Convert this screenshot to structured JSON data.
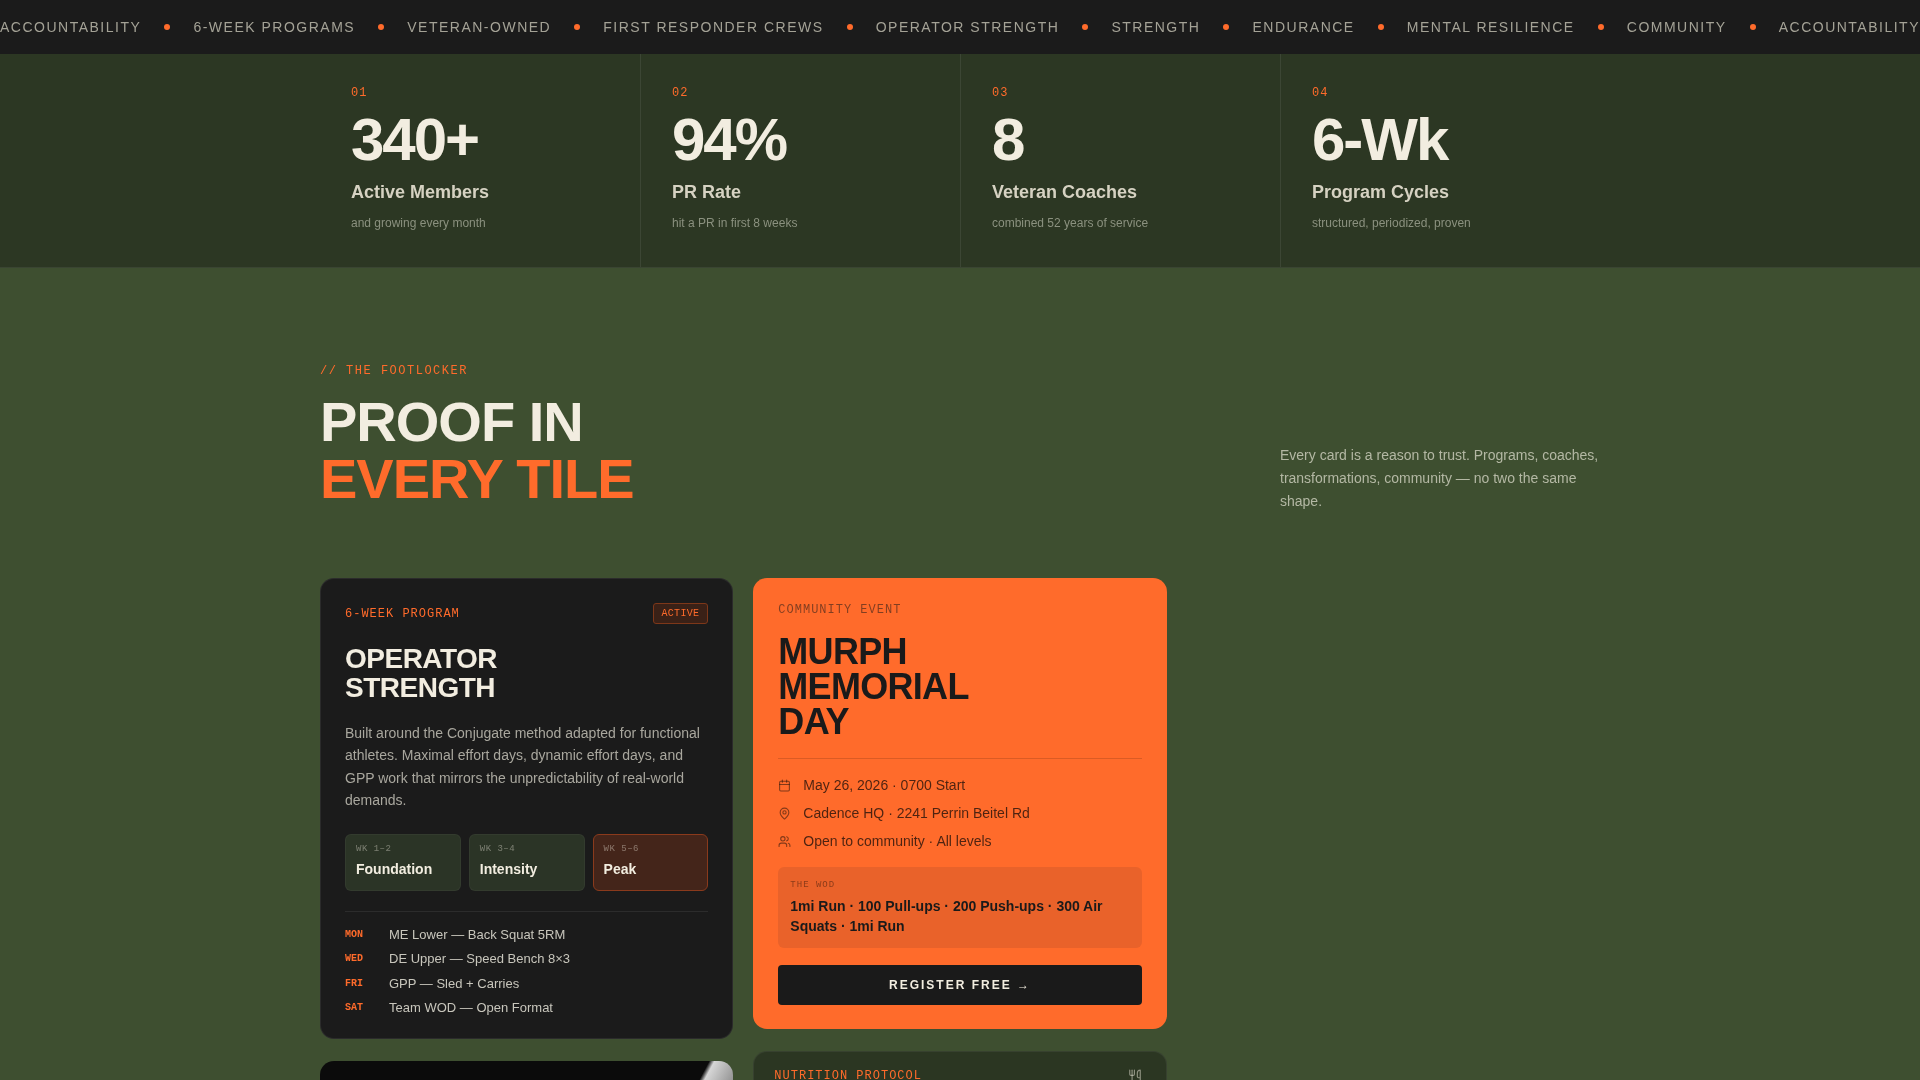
{
  "ticker": {
    "items": [
      "ACCOUNTABILITY",
      "6-WEEK PROGRAMS",
      "VETERAN-OWNED",
      "FIRST RESPONDER CREWS",
      "OPERATOR STRENGTH",
      "STRENGTH",
      "ENDURANCE",
      "MENTAL RESILIENCE",
      "COMMUNITY",
      "ACCOUNTABILITY"
    ]
  },
  "stats": [
    {
      "index": "01",
      "value": "340+",
      "label": "Active Members",
      "note": "and growing every month"
    },
    {
      "index": "02",
      "value": "94%",
      "label": "PR Rate",
      "note": "hit a PR in first 8 weeks"
    },
    {
      "index": "03",
      "value": "8",
      "label": "Veteran Coaches",
      "note": "combined 52 years of service"
    },
    {
      "index": "04",
      "value": "6-Wk",
      "label": "Program Cycles",
      "note": "structured, periodized, proven"
    }
  ],
  "section": {
    "eyebrow": "// THE FOOTLOCKER",
    "title": "PROOF IN",
    "title_accent": "EVERY TILE",
    "intro": "Every card is a reason to trust. Programs, coaches, transformations, community — no two the same shape."
  },
  "tile_columns": [
    [
      {
        "kind": "program",
        "eyebrow": "6-WEEK PROGRAM",
        "badge": "ACTIVE",
        "title": "OPERATOR STRENGTH",
        "description": "Built around the Conjugate method adapted for functional athletes. Maximal effort days, dynamic effort days, and GPP work that mirrors the unpredictability of real-world demands.",
        "phases": [
          {
            "weeks": "WK 1–2",
            "name": "Foundation",
            "current": false
          },
          {
            "weeks": "WK 3–4",
            "name": "Intensity",
            "current": false
          },
          {
            "weeks": "WK 5–6",
            "name": "Peak",
            "current": true
          }
        ],
        "schedule": [
          {
            "day": "MON",
            "session": "ME Lower — Back Squat 5RM"
          },
          {
            "day": "WED",
            "session": "DE Upper — Speed Bench 8×3"
          },
          {
            "day": "FRI",
            "session": "GPP — Sled + Carries"
          },
          {
            "day": "SAT",
            "session": "Team WOD — Open Format"
          }
        ]
      },
      {
        "kind": "photo"
      }
    ],
    [
      {
        "kind": "event",
        "eyebrow": "COMMUNITY EVENT",
        "title": "MURPH MEMORIAL DAY",
        "details": [
          {
            "kind": "date",
            "text": "May 26, 2026 · 0700 Start"
          },
          {
            "kind": "location",
            "text": "Cadence HQ · 2241 Perrin Beitel Rd"
          },
          {
            "kind": "audience",
            "text": "Open to community · All levels"
          }
        ],
        "wod": {
          "label": "THE WOD",
          "text": "1mi Run · 100 Pull-ups · 200 Push-ups · 300 Air Squats · 1mi Run"
        },
        "button": "REGISTER FREE →"
      },
      {
        "kind": "protocol",
        "eyebrow": "NUTRITION PROTOCOL"
      }
    ]
  ]
}
